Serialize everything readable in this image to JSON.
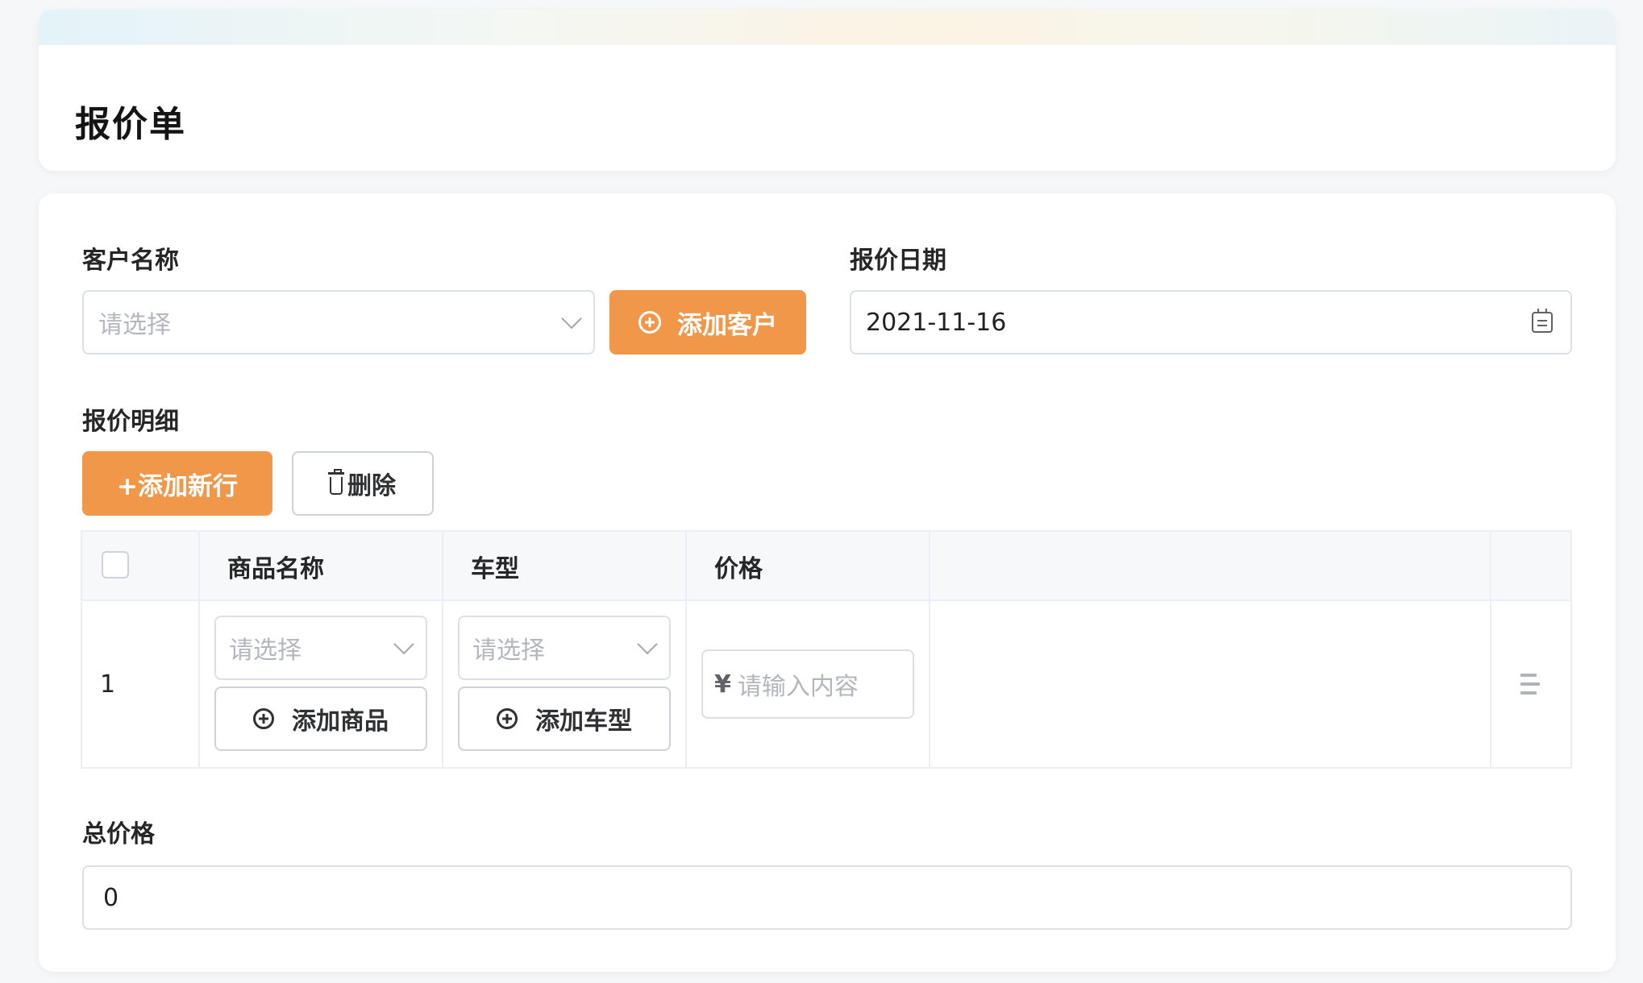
{
  "header": {
    "title": "报价单"
  },
  "form": {
    "customer": {
      "label": "客户名称",
      "placeholder": "请选择",
      "add_button": "添加客户"
    },
    "quote_date": {
      "label": "报价日期",
      "value": "2021-11-16"
    },
    "details": {
      "label": "报价明细",
      "add_row_button": "+添加新行",
      "delete_button": "删除",
      "columns": [
        "商品名称",
        "车型",
        "价格"
      ],
      "rows": [
        {
          "index": "1",
          "product_placeholder": "请选择",
          "add_product_button": "添加商品",
          "model_placeholder": "请选择",
          "add_model_button": "添加车型",
          "price_prefix": "¥",
          "price_placeholder": "请输入内容"
        }
      ]
    },
    "total": {
      "label": "总价格",
      "value": "0"
    }
  },
  "colors": {
    "primary": "#f0974a",
    "border": "#dcdfe6",
    "header_bg": "#f7f8fa"
  },
  "icons": [
    "chevron-down-icon",
    "plus-circle-icon",
    "calendar-icon",
    "trash-icon",
    "row-menu-icon"
  ]
}
